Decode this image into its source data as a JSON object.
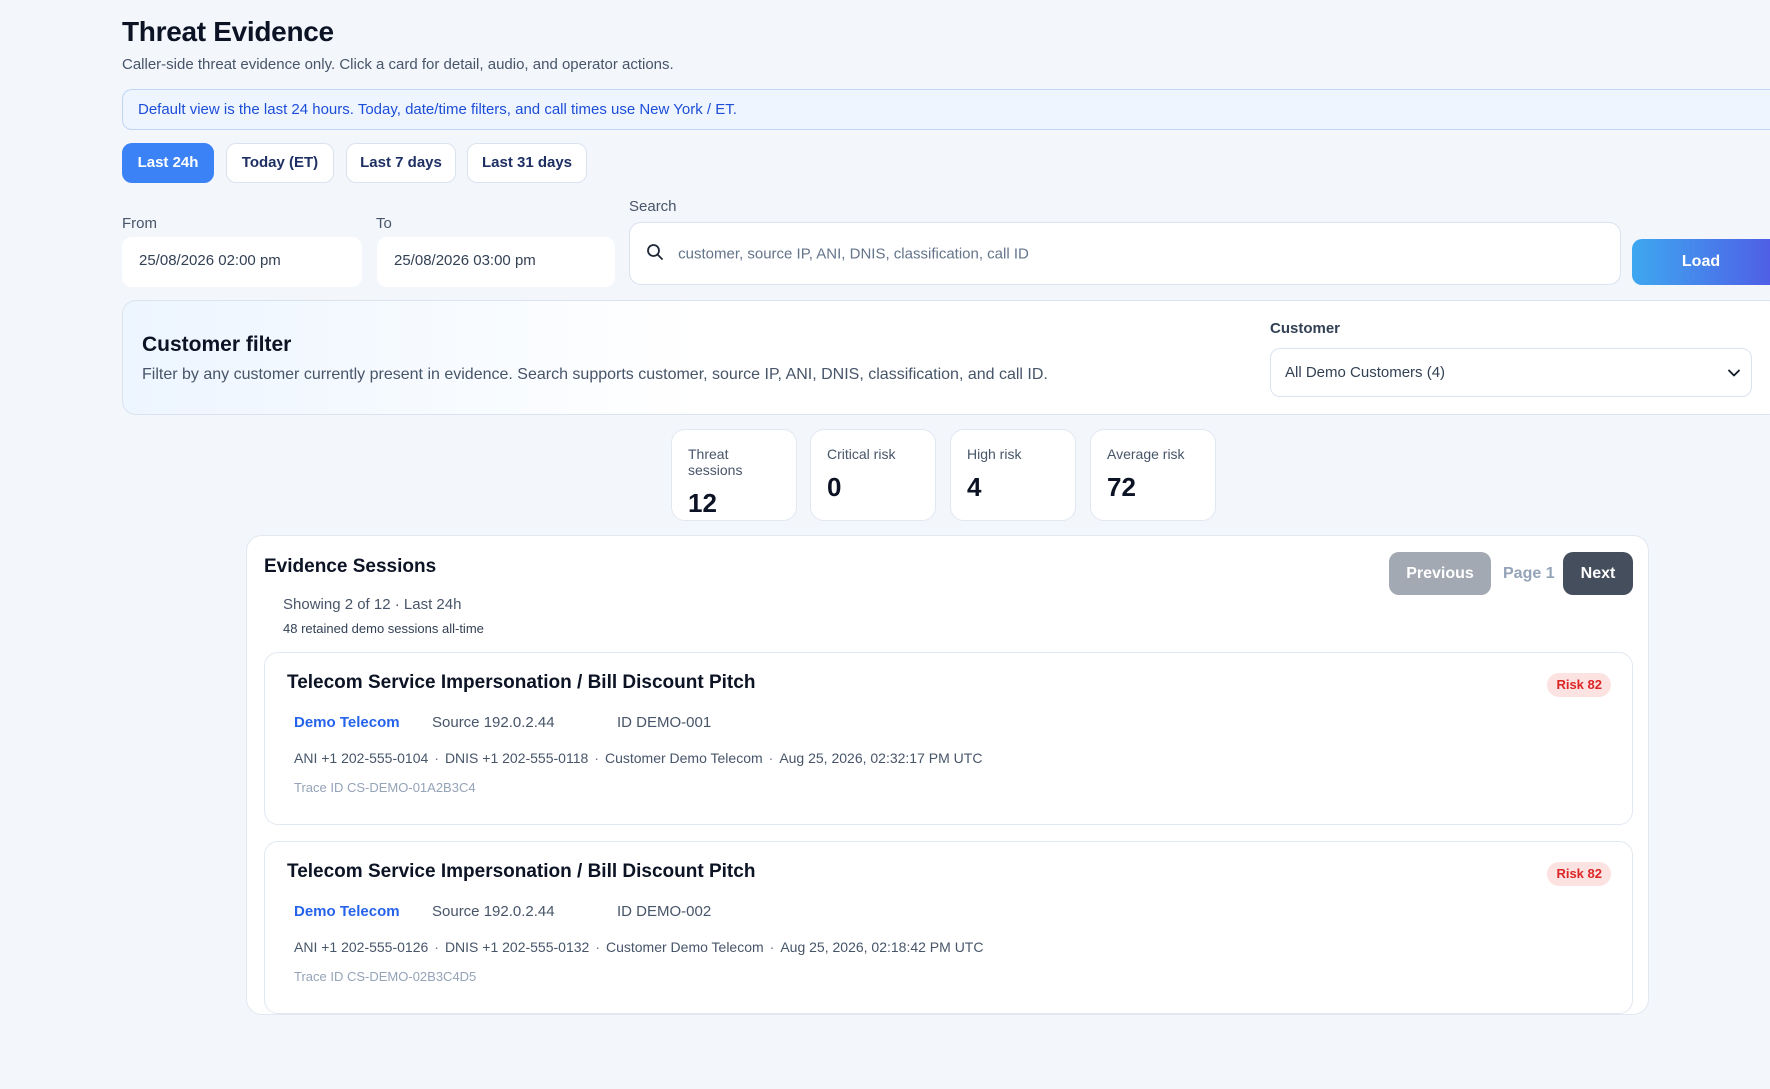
{
  "header": {
    "title": "Threat Evidence",
    "subtitle": "Caller-side threat evidence only. Click a card for detail, audio, and operator actions."
  },
  "banner": {
    "text": "Default view is the last 24 hours. Today, date/time filters, and call times use New York / ET."
  },
  "range_buttons": [
    {
      "label": "Last 24h",
      "active": true
    },
    {
      "label": "Today (ET)",
      "active": false
    },
    {
      "label": "Last 7 days",
      "active": false
    },
    {
      "label": "Last 31 days",
      "active": false
    }
  ],
  "filters": {
    "from_label": "From",
    "from_value": "25/08/2026 02:00 pm",
    "to_label": "To",
    "to_value": "25/08/2026 03:00 pm",
    "search_label": "Search",
    "search_placeholder": "customer, source IP, ANI, DNIS, classification, call ID",
    "load_label": "Load"
  },
  "customer_filter": {
    "title": "Customer filter",
    "description": "Filter by any customer currently present in evidence. Search supports customer, source IP, ANI, DNIS, classification, and call ID.",
    "label": "Customer",
    "selected": "All Demo Customers (4)"
  },
  "stats": [
    {
      "label": "Threat sessions",
      "value": "12"
    },
    {
      "label": "Critical risk",
      "value": "0"
    },
    {
      "label": "High risk",
      "value": "4"
    },
    {
      "label": "Average risk",
      "value": "72"
    }
  ],
  "sessions": {
    "title": "Evidence Sessions",
    "showing": "Showing 2 of 12 · Last 24h",
    "retained": "48 retained demo sessions all-time",
    "pagination": {
      "previous": "Previous",
      "page": "Page 1",
      "next": "Next"
    },
    "cards": [
      {
        "title": "Telecom Service Impersonation / Bill Discount Pitch",
        "risk": "Risk 82",
        "customer": "Demo Telecom",
        "source": "Source 192.0.2.44",
        "id": "ID DEMO-001",
        "ani": "ANI +1 202-555-0104",
        "dnis": "DNIS +1 202-555-0118",
        "customer_detail": "Customer Demo Telecom",
        "time": "Aug 25, 2026, 02:32:17 PM UTC",
        "trace": "Trace ID CS-DEMO-01A2B3C4"
      },
      {
        "title": "Telecom Service Impersonation / Bill Discount Pitch",
        "risk": "Risk 82",
        "customer": "Demo Telecom",
        "source": "Source 192.0.2.44",
        "id": "ID DEMO-002",
        "ani": "ANI +1 202-555-0126",
        "dnis": "DNIS +1 202-555-0132",
        "customer_detail": "Customer Demo Telecom",
        "time": "Aug 25, 2026, 02:18:42 PM UTC",
        "trace": "Trace ID CS-DEMO-02B3C4D5"
      }
    ]
  },
  "colors": {
    "accent": "#3b82f6",
    "risk": "#dc2626",
    "customer_link": "#2563eb"
  },
  "icons": {
    "search": "search-icon",
    "dropdown": "chevron-down-icon"
  }
}
